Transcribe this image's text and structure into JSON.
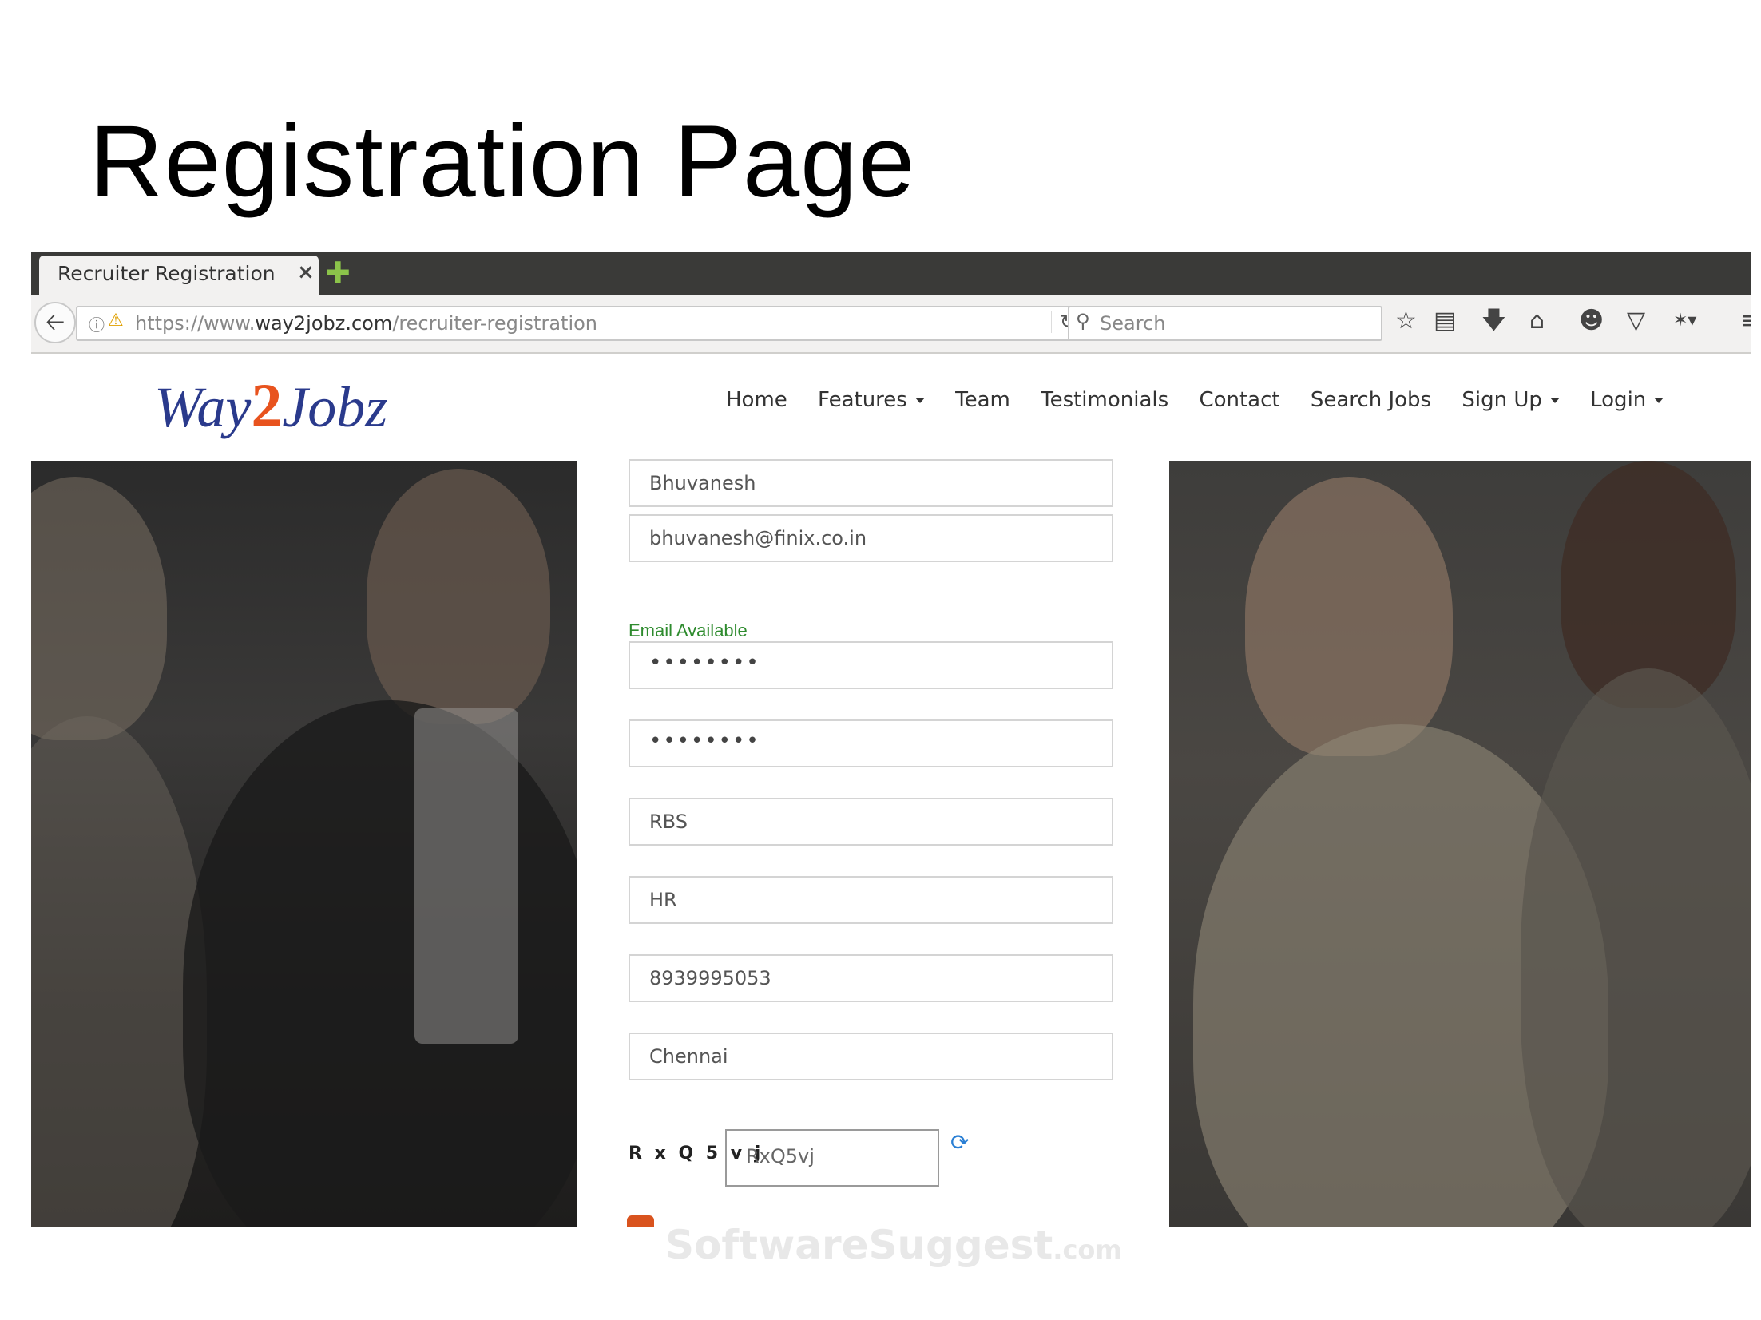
{
  "slide": {
    "title": "Registration Page"
  },
  "browser": {
    "tab_title": "Recruiter Registration",
    "tab_close": "×",
    "new_tab": "✚",
    "url_prefix": "https://www.",
    "url_domain": "way2jobz.com",
    "url_path": "/recruiter-registration",
    "search_placeholder": "Search"
  },
  "site": {
    "logo_left": "Way",
    "logo_mid": "2",
    "logo_right": "Jobz",
    "nav": {
      "home": "Home",
      "features": "Features",
      "team": "Team",
      "testimonials": "Testimonials",
      "contact": "Contact",
      "search_jobs": "Search Jobs",
      "sign_up": "Sign Up",
      "login": "Login"
    }
  },
  "form": {
    "name": "Bhuvanesh",
    "email": "bhuvanesh@finix.co.in",
    "email_status": "Email Available",
    "password": "••••••••",
    "confirm_password": "••••••••",
    "company": "RBS",
    "designation": "HR",
    "phone": "8939995053",
    "city": "Chennai",
    "captcha_text": "R x Q 5 v j",
    "captcha_input": "RxQ5vj"
  },
  "watermark": {
    "main": "SoftwareSuggest",
    "suffix": ".com"
  },
  "colors": {
    "email_status": "#2e8b2e",
    "logo_blue": "#2a3a8c",
    "logo_orange": "#e8531e",
    "refresh": "#2a7fd4"
  }
}
